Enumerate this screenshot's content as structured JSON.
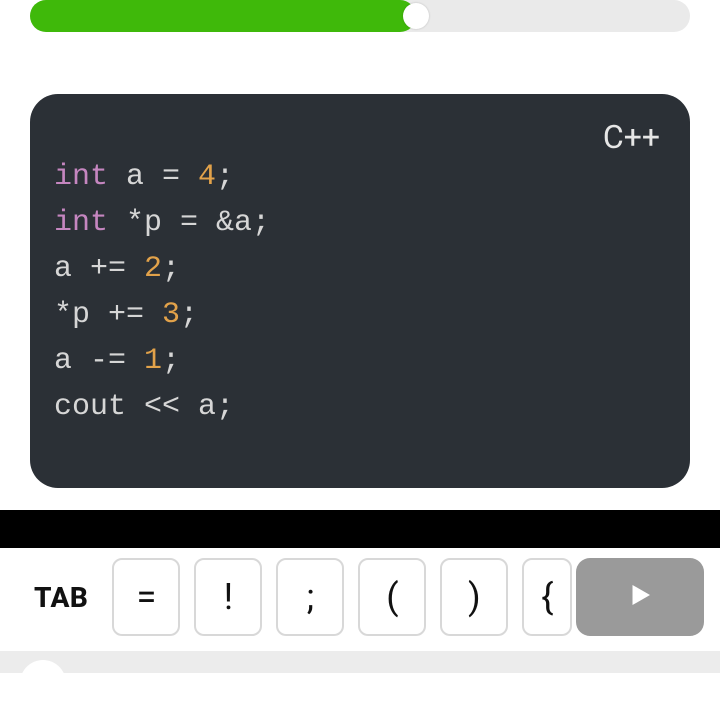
{
  "progress": {
    "percent": 58.5
  },
  "code": {
    "lang": "C++",
    "lines": [
      [
        {
          "t": "type",
          "s": "int"
        },
        {
          "t": "",
          "s": " a = "
        },
        {
          "t": "num",
          "s": "4"
        },
        {
          "t": "",
          "s": ";"
        }
      ],
      [
        {
          "t": "type",
          "s": "int"
        },
        {
          "t": "",
          "s": " *p = &a;"
        }
      ],
      [
        {
          "t": "",
          "s": "a += "
        },
        {
          "t": "num",
          "s": "2"
        },
        {
          "t": "",
          "s": ";"
        }
      ],
      [
        {
          "t": "",
          "s": "*p += "
        },
        {
          "t": "num",
          "s": "3"
        },
        {
          "t": "",
          "s": ";"
        }
      ],
      [
        {
          "t": "",
          "s": "a -= "
        },
        {
          "t": "num",
          "s": "1"
        },
        {
          "t": "",
          "s": ";"
        }
      ],
      [
        {
          "t": "",
          "s": "cout << a;"
        }
      ]
    ]
  },
  "keyboard": {
    "tab_label": "TAB",
    "keys": [
      "=",
      "!",
      ";",
      "(",
      ")",
      "{"
    ]
  }
}
